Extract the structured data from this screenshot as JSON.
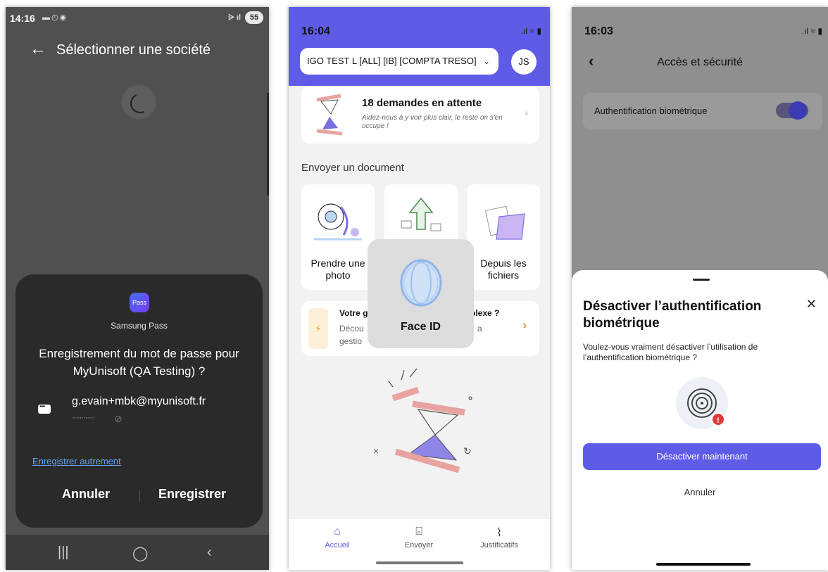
{
  "screen1": {
    "status_time": "14:16",
    "battery": "55",
    "title": "Sélectionner une société",
    "provider_logo": "Pass",
    "provider_name": "Samsung Pass",
    "prompt": "Enregistrement du mot de passe pour MyUnisoft (QA Testing) ?",
    "email": "g.evain+mbk@myunisoft.fr",
    "password_mask": "············",
    "other_link": "Enregistrer autrement",
    "cancel": "Annuler",
    "save": "Enregistrer"
  },
  "screen2": {
    "status_time": "16:04",
    "company": "IGO TEST L [ALL] [IB] [COMPTA TRESO]",
    "user_initials": "JS",
    "pending_title": "18 demandes en attente",
    "pending_sub": "Aidez-nous à y voir plus clair, le reste on s'en occupe !",
    "section_title": "Envoyer un document",
    "tiles": [
      {
        "label": "Prendre une photo"
      },
      {
        "label": ""
      },
      {
        "label": "Depuis les fichiers"
      }
    ],
    "info_t1": "Votre g",
    "info_t2": "Décou",
    "info_t3": "gestio",
    "info_t4": "plexe ?",
    "info_t5": "a",
    "faceid_label": "Face ID",
    "tabs": [
      {
        "label": "Accueil"
      },
      {
        "label": "Envoyer"
      },
      {
        "label": "Justificatifs"
      }
    ],
    "accent_color": "#5e5ce6"
  },
  "screen3": {
    "status_time": "16:03",
    "title": "Accès et sécurité",
    "row_label": "Authentification biométrique",
    "sheet_title": "Désactiver l’authentification biométrique",
    "sheet_desc": "Voulez-vous vraiment désactiver l’utilisation de l’authentification biométrique ?",
    "primary_button": "Désactiver maintenant",
    "secondary_button": "Annuler"
  }
}
